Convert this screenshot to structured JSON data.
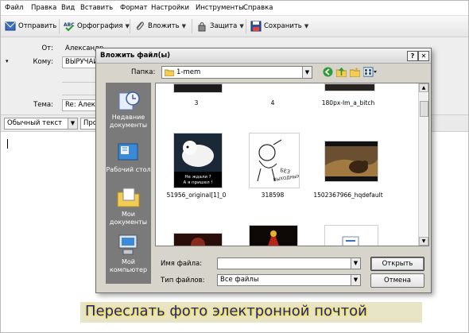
{
  "menu": [
    "Файл",
    "Правка",
    "Вид",
    "Вставить",
    "Формат",
    "Настройки",
    "Инструменты",
    "Справка"
  ],
  "toolbar": {
    "send": "Отправить",
    "spell": "Орфография",
    "attach": "Вложить",
    "security": "Защита",
    "save": "Сохранить"
  },
  "header": {
    "from_label": "От:",
    "from_value": "Александр",
    "to_label": "Кому:",
    "to_value": "ВЫРУЧАЙ-К",
    "subject_label": "Тема:",
    "subject_value": "Re: Алекса"
  },
  "format_bar": {
    "style_value": "Обычный текст",
    "font_value": "Проп"
  },
  "dialog": {
    "title": "Вложить файл(ы)",
    "help_btn": "?",
    "close_btn": "✕",
    "folder_label": "Папка:",
    "folder_value": "1-mem",
    "places": [
      "Недавние документы",
      "Рабочий стол",
      "Мои документы",
      "Мой компьютер"
    ],
    "files": [
      {
        "name": "3",
        "thumb": "top-dark"
      },
      {
        "name": "4",
        "thumb": "none"
      },
      {
        "name": "180px-Im_a_bitch",
        "thumb": "top-dark"
      },
      {
        "name": "51956_original[1]_0",
        "thumb": "snow-fox",
        "caption1": "Не ждали ?",
        "caption2": "А я пришел !"
      },
      {
        "name": "318598",
        "thumb": "sketch",
        "sketch_text": "БЕЗ ВЫХОДНЫХ !!!"
      },
      {
        "name": "1502367966_hqdefault",
        "thumb": "bear"
      },
      {
        "name": "",
        "thumb": "dark-red"
      },
      {
        "name": "",
        "thumb": "eagle"
      },
      {
        "name": "",
        "thumb": "doc"
      }
    ],
    "filename_label": "Имя файла:",
    "filename_value": "",
    "filetype_label": "Тип файлов:",
    "filetype_value": "Все файлы",
    "open_btn": "Открыть",
    "cancel_btn": "Отмена"
  },
  "caption": "Переслать фото электронной почтой"
}
